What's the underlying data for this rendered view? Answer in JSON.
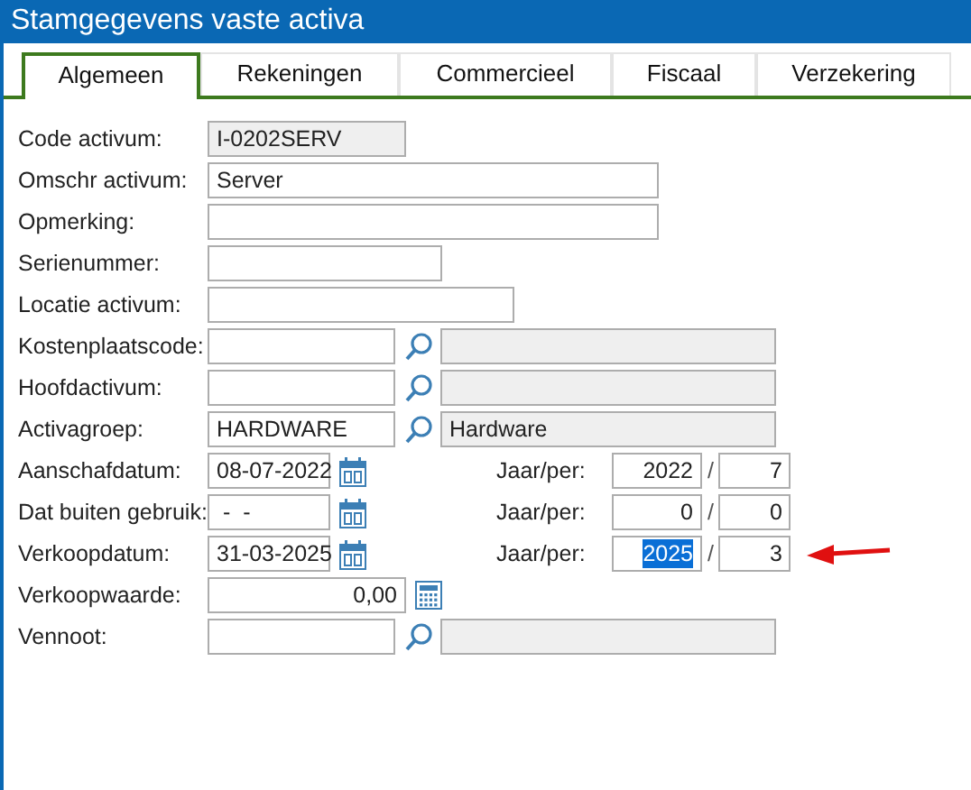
{
  "window": {
    "title": "Stamgegevens vaste activa"
  },
  "tabs": [
    {
      "label": "Algemeen",
      "selected": true
    },
    {
      "label": "Rekeningen",
      "selected": false
    },
    {
      "label": "Commercieel",
      "selected": false
    },
    {
      "label": "Fiscaal",
      "selected": false
    },
    {
      "label": "Verzekering",
      "selected": false
    }
  ],
  "fields": [
    {
      "label": "Code activum:",
      "kind": "readonly",
      "value": "I-0202SERV"
    },
    {
      "label": "Omschr activum:",
      "kind": "text",
      "value": "Server"
    },
    {
      "label": "Opmerking:",
      "kind": "text"
    },
    {
      "label": "Serienummer:",
      "kind": "short-text"
    },
    {
      "label": "Locatie activum:",
      "kind": "medium-text"
    },
    {
      "label": "Kostenplaatscode:",
      "kind": "lookup"
    },
    {
      "label": "Hoofdactivum:",
      "kind": "lookup"
    },
    {
      "label": "Activagroep:",
      "kind": "lookup",
      "value": "HARDWARE",
      "description": "Hardware"
    },
    {
      "label": "Aanschafdatum:",
      "kind": "date",
      "value": "08-07-2022",
      "period_label": "Jaar/per:",
      "year": "2022",
      "separator": "/",
      "period": "7",
      "year_selected": false,
      "arrow": false
    },
    {
      "label": "Dat buiten gebruik:",
      "kind": "date",
      "value": " -  -",
      "period_label": "Jaar/per:",
      "year": "0",
      "separator": "/",
      "period": "0",
      "year_selected": false,
      "arrow": false
    },
    {
      "label": "Verkoopdatum:",
      "kind": "date",
      "value": "31-03-2025",
      "period_label": "Jaar/per:",
      "year": "2025",
      "separator": "/",
      "period": "3",
      "year_selected": true,
      "arrow": true
    },
    {
      "label": "Verkoopwaarde:",
      "kind": "amount",
      "value": "0,00"
    },
    {
      "label": "Vennoot:",
      "kind": "lookup"
    }
  ]
}
